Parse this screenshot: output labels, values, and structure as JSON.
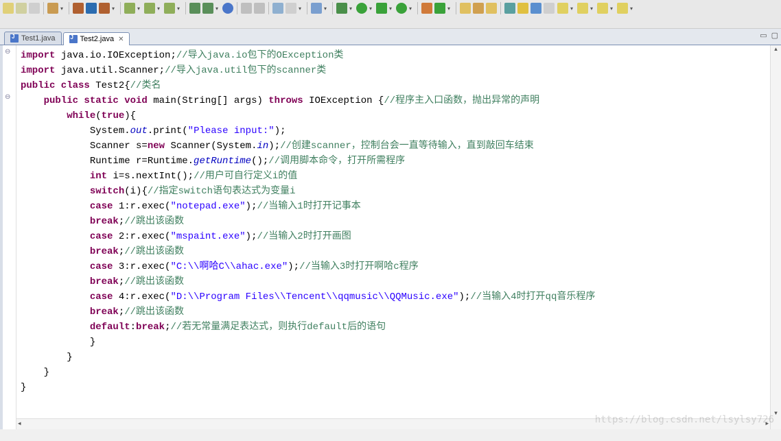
{
  "toolbar_icons": [
    "save",
    "save-all",
    "print",
    "sep",
    "box",
    "drop",
    "sep",
    "pkg1",
    "pkg2",
    "pkg-drop",
    "sep",
    "wand",
    "wand2",
    "wand3",
    "drop",
    "sep",
    "link1",
    "link2",
    "drop",
    "globe",
    "sep",
    "cut",
    "paste",
    "sep",
    "chart",
    "pin",
    "drop",
    "sep",
    "pic",
    "drop",
    "sep",
    "bug",
    "drop",
    "run",
    "drop",
    "run-ext",
    "drop",
    "run-cfg",
    "drop",
    "sep",
    "stop",
    "restart",
    "drop",
    "sep",
    "folder",
    "key",
    "folder2",
    "sep",
    "task",
    "pencil",
    "book",
    "page",
    "sep"
  ],
  "toolbar_row2": [
    "hand",
    "drop",
    "arrow",
    "drop",
    "back",
    "drop",
    "fwd",
    "drop"
  ],
  "tabs": [
    {
      "label": "Test1.java",
      "active": false
    },
    {
      "label": "Test2.java",
      "active": true
    }
  ],
  "code_lines": [
    {
      "t": [
        {
          "c": "kw",
          "s": "import"
        },
        {
          "c": "",
          "s": " java.io.IOException;"
        },
        {
          "c": "cm",
          "s": "//导入java.io包下的OException类"
        }
      ]
    },
    {
      "t": [
        {
          "c": "kw",
          "s": "import"
        },
        {
          "c": "",
          "s": " java.util.Scanner;"
        },
        {
          "c": "cm",
          "s": "//导入java.util包下的scanner类"
        }
      ]
    },
    {
      "t": [
        {
          "c": "kw",
          "s": "public class"
        },
        {
          "c": "",
          "s": " Test2{"
        },
        {
          "c": "cm",
          "s": "//类名"
        }
      ]
    },
    {
      "t": [
        {
          "c": "",
          "s": "    "
        },
        {
          "c": "kw",
          "s": "public static void"
        },
        {
          "c": "",
          "s": " main(String[] args) "
        },
        {
          "c": "kw",
          "s": "throws"
        },
        {
          "c": "",
          "s": " IOException {"
        },
        {
          "c": "cm",
          "s": "//程序主入口函数，抛出异常的声明"
        }
      ]
    },
    {
      "t": [
        {
          "c": "",
          "s": "        "
        },
        {
          "c": "kw",
          "s": "while"
        },
        {
          "c": "",
          "s": "("
        },
        {
          "c": "kw",
          "s": "true"
        },
        {
          "c": "",
          "s": "){"
        }
      ]
    },
    {
      "t": [
        {
          "c": "",
          "s": "            System."
        },
        {
          "c": "fld",
          "s": "out"
        },
        {
          "c": "",
          "s": ".print("
        },
        {
          "c": "str",
          "s": "\"Please input:\""
        },
        {
          "c": "",
          "s": ");"
        }
      ]
    },
    {
      "t": [
        {
          "c": "",
          "s": "            Scanner s="
        },
        {
          "c": "kw",
          "s": "new"
        },
        {
          "c": "",
          "s": " Scanner(System."
        },
        {
          "c": "fld",
          "s": "in"
        },
        {
          "c": "",
          "s": ");"
        },
        {
          "c": "cm",
          "s": "//创建scanner，控制台会一直等待输入，直到敲回车结束"
        }
      ]
    },
    {
      "t": [
        {
          "c": "",
          "s": "            Runtime r=Runtime."
        },
        {
          "c": "fld",
          "s": "getRuntime"
        },
        {
          "c": "",
          "s": "();"
        },
        {
          "c": "cm",
          "s": "//调用脚本命令，打开所需程序"
        }
      ]
    },
    {
      "t": [
        {
          "c": "",
          "s": "            "
        },
        {
          "c": "kw",
          "s": "int"
        },
        {
          "c": "",
          "s": " i=s.nextInt();"
        },
        {
          "c": "cm",
          "s": "//用户可自行定义i的值"
        }
      ]
    },
    {
      "t": [
        {
          "c": "",
          "s": "            "
        },
        {
          "c": "kw",
          "s": "switch"
        },
        {
          "c": "",
          "s": "(i){"
        },
        {
          "c": "cm",
          "s": "//指定switch语句表达式为变量i"
        }
      ]
    },
    {
      "t": [
        {
          "c": "",
          "s": "            "
        },
        {
          "c": "kw",
          "s": "case"
        },
        {
          "c": "",
          "s": " 1:r.exec("
        },
        {
          "c": "str",
          "s": "\"notepad.exe\""
        },
        {
          "c": "",
          "s": ");"
        },
        {
          "c": "cm",
          "s": "//当输入1时打开记事本"
        }
      ]
    },
    {
      "t": [
        {
          "c": "",
          "s": "            "
        },
        {
          "c": "kw",
          "s": "break"
        },
        {
          "c": "",
          "s": ";"
        },
        {
          "c": "cm",
          "s": "//跳出该函数"
        }
      ]
    },
    {
      "t": [
        {
          "c": "",
          "s": "            "
        },
        {
          "c": "kw",
          "s": "case"
        },
        {
          "c": "",
          "s": " 2:r.exec("
        },
        {
          "c": "str",
          "s": "\"mspaint.exe\""
        },
        {
          "c": "",
          "s": ");"
        },
        {
          "c": "cm",
          "s": "//当输入2时打开画图"
        }
      ]
    },
    {
      "t": [
        {
          "c": "",
          "s": "            "
        },
        {
          "c": "kw",
          "s": "break"
        },
        {
          "c": "",
          "s": ";"
        },
        {
          "c": "cm",
          "s": "//跳出该函数"
        }
      ]
    },
    {
      "t": [
        {
          "c": "",
          "s": "            "
        },
        {
          "c": "kw",
          "s": "case"
        },
        {
          "c": "",
          "s": " 3:r.exec("
        },
        {
          "c": "str",
          "s": "\"C:\\\\啊哈C\\\\ahac.exe\""
        },
        {
          "c": "",
          "s": ");"
        },
        {
          "c": "cm",
          "s": "//当输入3时打开啊哈c程序"
        }
      ]
    },
    {
      "t": [
        {
          "c": "",
          "s": "            "
        },
        {
          "c": "kw",
          "s": "break"
        },
        {
          "c": "",
          "s": ";"
        },
        {
          "c": "cm",
          "s": "//跳出该函数"
        }
      ]
    },
    {
      "t": [
        {
          "c": "",
          "s": "            "
        },
        {
          "c": "kw",
          "s": "case"
        },
        {
          "c": "",
          "s": " 4:r.exec("
        },
        {
          "c": "str",
          "s": "\"D:\\\\Program Files\\\\Tencent\\\\qqmusic\\\\QQMusic.exe\""
        },
        {
          "c": "",
          "s": ");"
        },
        {
          "c": "cm",
          "s": "//当输入4时打开qq音乐程序"
        }
      ]
    },
    {
      "t": [
        {
          "c": "",
          "s": "            "
        },
        {
          "c": "kw",
          "s": "break"
        },
        {
          "c": "",
          "s": ";"
        },
        {
          "c": "cm",
          "s": "//跳出该函数"
        }
      ]
    },
    {
      "t": [
        {
          "c": "",
          "s": "            "
        },
        {
          "c": "kw",
          "s": "default"
        },
        {
          "c": "",
          "s": ":"
        },
        {
          "c": "kw",
          "s": "break"
        },
        {
          "c": "",
          "s": ";"
        },
        {
          "c": "cm",
          "s": "//若无常量满足表达式，则执行default后的语句"
        }
      ]
    },
    {
      "t": [
        {
          "c": "",
          "s": "            }"
        }
      ]
    },
    {
      "t": [
        {
          "c": "",
          "s": "        }"
        }
      ]
    },
    {
      "t": [
        {
          "c": "",
          "s": "    }"
        }
      ]
    },
    {
      "t": [
        {
          "c": "",
          "s": "}"
        }
      ]
    }
  ],
  "fold_markers": [
    {
      "line": 0,
      "sym": "⊖"
    },
    {
      "line": 3,
      "sym": "⊖"
    }
  ],
  "watermark": "https://blog.csdn.net/lsylsy726"
}
